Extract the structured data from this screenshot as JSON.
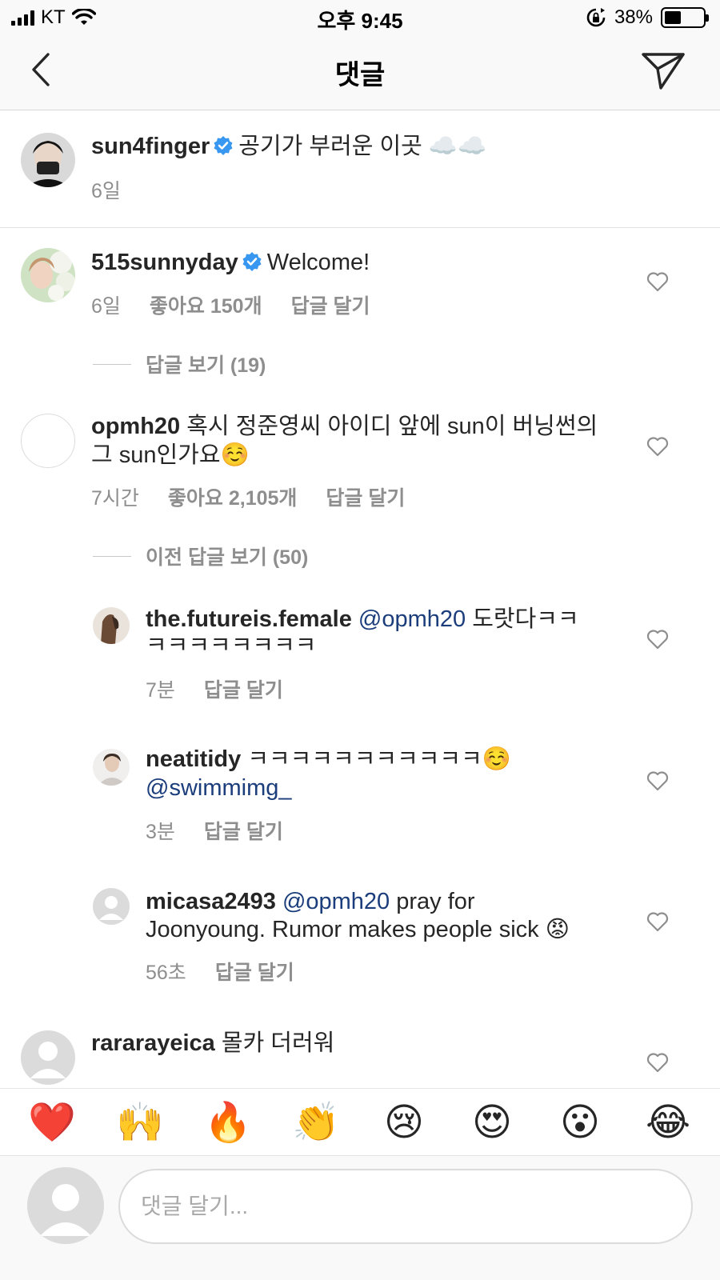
{
  "status_bar": {
    "carrier": "KT",
    "time": "오후 9:45",
    "battery": "38%",
    "battery_level": 0.38
  },
  "nav": {
    "title": "댓글",
    "back_icon": "chevron-left-icon",
    "send_icon": "paper-plane-icon"
  },
  "caption": {
    "username": "sun4finger",
    "verified": true,
    "text": "공기가 부러운 이곳 ☁️☁️",
    "time": "6일"
  },
  "comments": [
    {
      "username": "515sunnyday",
      "verified": true,
      "text": "Welcome!",
      "time": "6일",
      "likes": "좋아요 150개",
      "reply": "답글 달기",
      "view_replies": "답글 보기 (19)"
    },
    {
      "username": "opmh20",
      "text_line1": "혹시 정준영씨 아이디 앞에 sun이 버닝썬의",
      "text_line2": "그 sun인가요☺️",
      "time": "7시간",
      "likes": "좋아요 2,105개",
      "reply": "답글 달기",
      "view_previous": "이전 답글 보기 (50)"
    }
  ],
  "replies": [
    {
      "username": "the.futureis.female",
      "mention": "@opmh20",
      "text_line1": "도랏다ㅋㅋ",
      "text_line2": "ㅋㅋㅋㅋㅋㅋㅋㅋ",
      "time": "7분",
      "reply": "답글 달기"
    },
    {
      "username": "neatitidy",
      "text_line1": "ㅋㅋㅋㅋㅋㅋㅋㅋㅋㅋㅋ☺️",
      "mention_line2": "@swimmimg_",
      "time": "3분",
      "reply": "답글 달기"
    },
    {
      "username": "micasa2493",
      "mention": "@opmh20",
      "text_line1": "pray for",
      "text_line2": "Joonyoung. Rumor makes people sick 😡",
      "time": "56초",
      "reply": "답글 달기"
    }
  ],
  "last_comment": {
    "username": "rararayeica",
    "text": "몰카 더러워"
  },
  "emoji_bar": [
    "❤️",
    "🙌",
    "🔥",
    "👏",
    "😢",
    "😍",
    "😮",
    "😂"
  ],
  "input": {
    "placeholder": "댓글 달기..."
  }
}
